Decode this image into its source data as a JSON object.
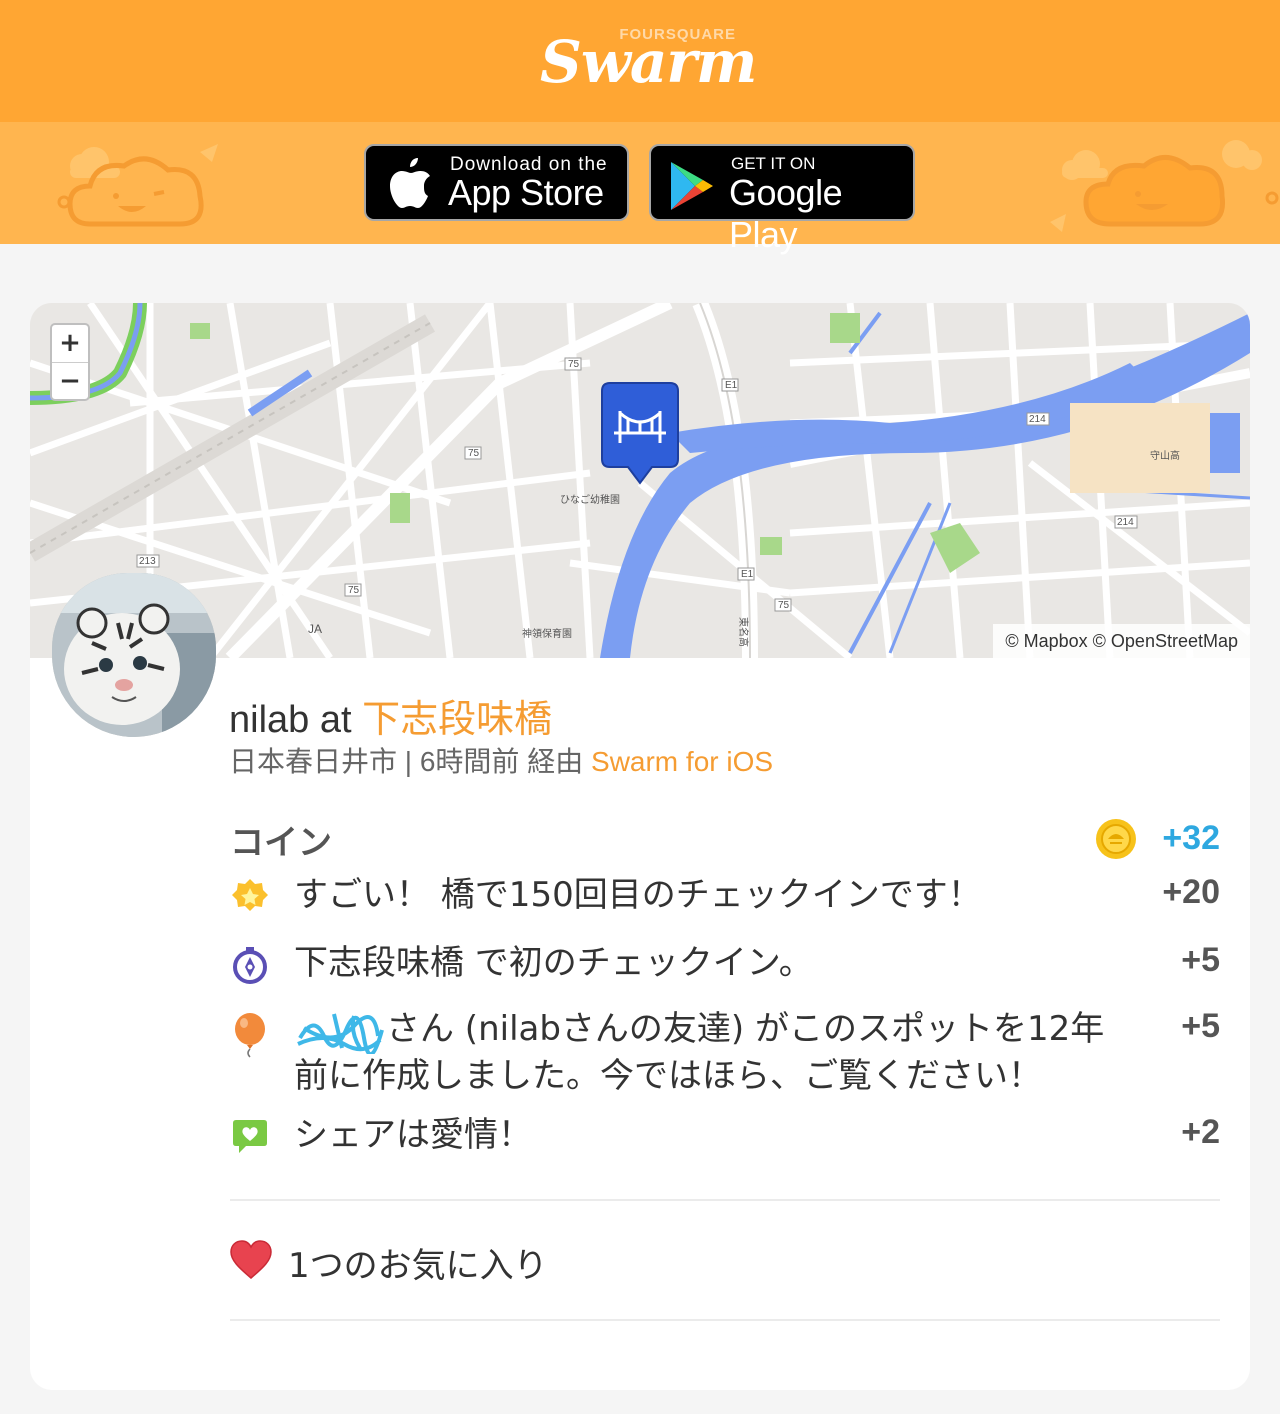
{
  "header": {
    "brand_small": "FOURSQUARE",
    "brand_large": "Swarm"
  },
  "stores": {
    "appstore_small": "Download on the",
    "appstore_big": "App Store",
    "googleplay_small": "GET IT ON",
    "googleplay_big": "Google Play"
  },
  "map": {
    "zoom_in": "+",
    "zoom_out": "−",
    "attribution": "© Mapbox © OpenStreetMap",
    "labels": [
      "75",
      "75",
      "75",
      "75",
      "E1",
      "E1",
      "214",
      "214",
      "213",
      "守山高",
      "ひなご幼稚園",
      "神領保育園",
      "JA",
      "東名高"
    ]
  },
  "checkin": {
    "user": "nilab",
    "at": "at",
    "venue": "下志段味橋",
    "location": "日本春日井市",
    "separator": "|",
    "time": "6時間前",
    "via": "経由",
    "app": "Swarm for iOS"
  },
  "coins": {
    "title": "コイン",
    "total": "+32",
    "items": [
      {
        "icon": "star-badge-icon",
        "text": "すごい！ 橋で150回目のチェックインです！",
        "value": "+20"
      },
      {
        "icon": "compass-icon",
        "text": "下志段味橋 で初のチェックイン。",
        "value": "+5"
      },
      {
        "icon": "balloon-icon",
        "text": "さん (nilabさんの友達) がこのスポットを12年前に作成しました。今ではほら、ご覧ください！",
        "value": "+5"
      },
      {
        "icon": "chat-heart-icon",
        "text": "シェアは愛情！",
        "value": "+2"
      }
    ]
  },
  "likes": {
    "text": "1つのお気に入り"
  },
  "colors": {
    "header_orange": "#ffa633",
    "band_orange": "#ffb54f",
    "accent_orange": "#f59c32",
    "coin_blue": "#2ea8e0",
    "river_blue": "#7b9ef2",
    "pin_blue": "#2f5ed8",
    "heart_red": "#e8434f"
  }
}
